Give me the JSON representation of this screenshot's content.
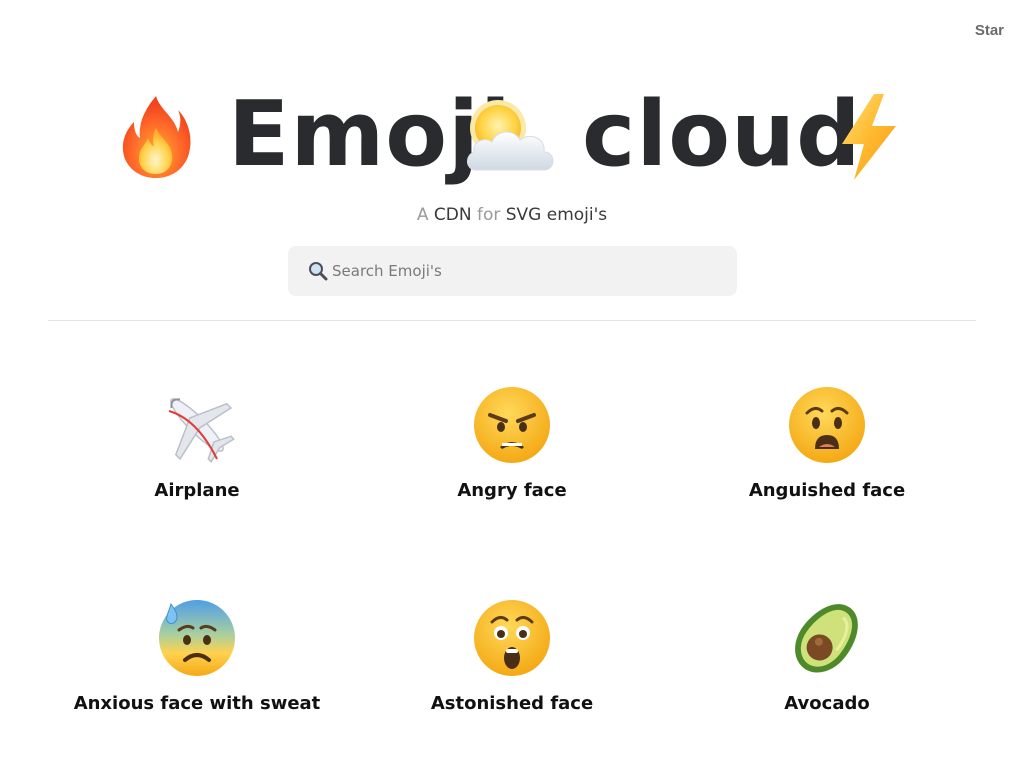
{
  "header": {
    "star_label": "Star"
  },
  "hero": {
    "word1": "Emoji",
    "word2": "cloud",
    "emojis": [
      "fire-icon",
      "sun-behind-cloud-icon",
      "high-voltage-icon"
    ]
  },
  "subtitle": {
    "part1": "A",
    "part2": "CDN",
    "part3": "for",
    "part4": "SVG emoji's"
  },
  "search": {
    "placeholder": "Search Emoji's",
    "value": ""
  },
  "emojis": [
    {
      "label": "Airplane",
      "icon": "airplane-icon"
    },
    {
      "label": "Angry face",
      "icon": "angry-face-icon"
    },
    {
      "label": "Anguished face",
      "icon": "anguished-face-icon"
    },
    {
      "label": "Anxious face with sweat",
      "icon": "anxious-face-with-sweat-icon"
    },
    {
      "label": "Astonished face",
      "icon": "astonished-face-icon"
    },
    {
      "label": "Avocado",
      "icon": "avocado-icon"
    }
  ],
  "colors": {
    "title": "#2a2b2e",
    "muted": "#9a9a9a",
    "search_bg": "#f2f2f2",
    "emoji_yellow": "#f6c034",
    "divider": "#e4e4e4"
  }
}
